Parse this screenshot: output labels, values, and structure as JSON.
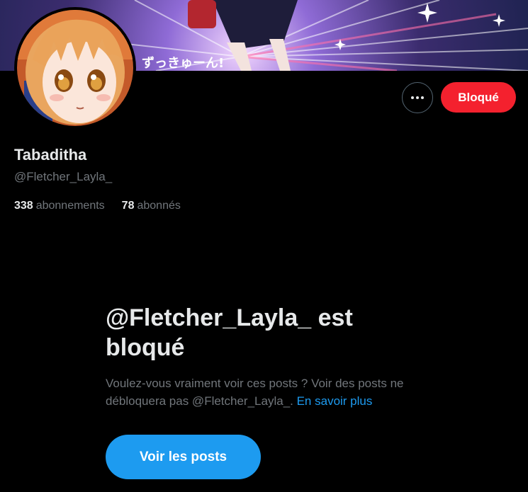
{
  "profile": {
    "display_name": "Tabaditha",
    "handle": "@Fletcher_Layla_",
    "banner_text": "ずっきゅーん!",
    "following_count": "338",
    "following_label": "abonnements",
    "followers_count": "78",
    "followers_label": "abonnés"
  },
  "actions": {
    "more_icon": "more-horizontal-icon",
    "blocked_label": "Bloqué"
  },
  "blocked_notice": {
    "title": "@Fletcher_Layla_ est bloqué",
    "description_part1": "Voulez-vous vraiment voir ces posts ? Voir des posts ne débloquera pas @Fletcher_Layla_. ",
    "learn_more": "En savoir plus",
    "view_posts_label": "Voir les posts"
  },
  "colors": {
    "background": "#000000",
    "text_primary": "#e7e9ea",
    "text_secondary": "#71767b",
    "accent_blue": "#1d9bf0",
    "blocked_red": "#f4212e"
  }
}
